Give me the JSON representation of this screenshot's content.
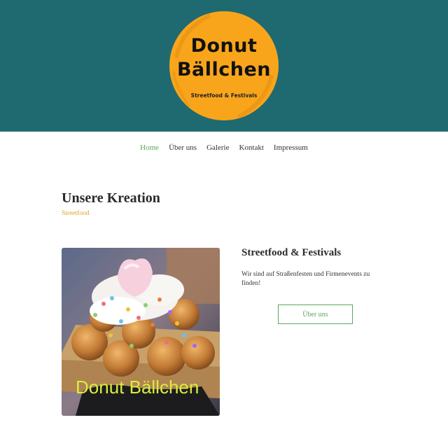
{
  "header": {
    "background_color": "#1e6a70",
    "logo": {
      "title_line1": "Donut",
      "title_line2": "Bällchen",
      "subtitle": "Streetfood & Festivals",
      "circle_color": "#f9a51c"
    }
  },
  "nav": {
    "items": [
      {
        "label": "Home",
        "active": true
      },
      {
        "label": "Über uns",
        "active": false
      },
      {
        "label": "Galerie",
        "active": false
      },
      {
        "label": "Kontakt",
        "active": false
      },
      {
        "label": "Impressum",
        "active": false
      }
    ],
    "active_color": "#5aa85a"
  },
  "main": {
    "title": "Unsere Kreation",
    "subtitle": "Streetfood",
    "photo": {
      "caption": "Donut Bällchen",
      "subject": "donut balls with cream, sprinkles and marshmallow in a paper tray"
    },
    "side": {
      "title": "Streetfood & Festivals",
      "text": "Wir sind auf Straßenfesten und Firmenevents zu finden!",
      "button_label": "Über uns"
    }
  }
}
